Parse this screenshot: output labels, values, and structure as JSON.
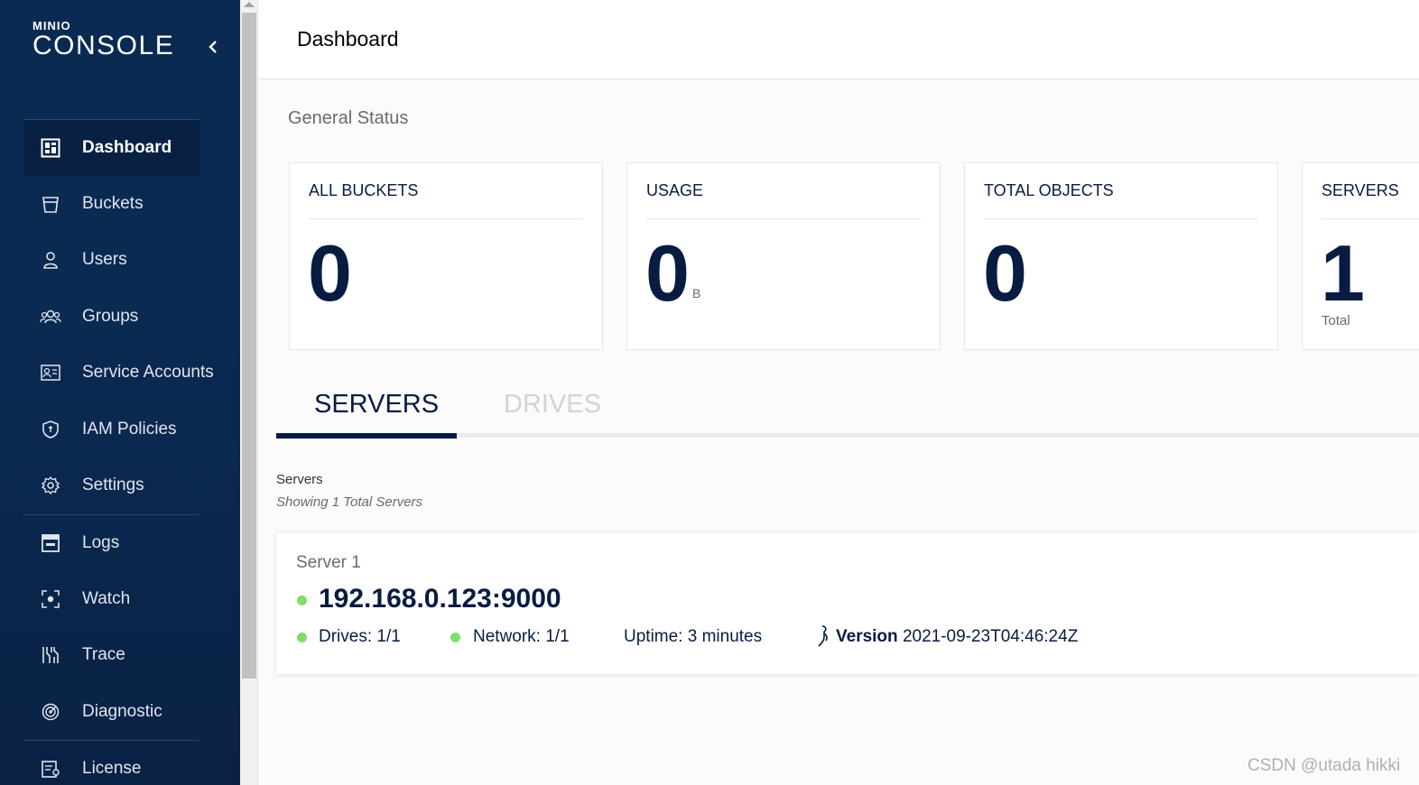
{
  "brand": {
    "top": "MINIO",
    "main": "CONSOLE"
  },
  "sidebar": {
    "items": [
      {
        "label": "Dashboard",
        "icon": "dashboard-icon"
      },
      {
        "label": "Buckets",
        "icon": "bucket-icon"
      },
      {
        "label": "Users",
        "icon": "user-icon"
      },
      {
        "label": "Groups",
        "icon": "groups-icon"
      },
      {
        "label": "Service Accounts",
        "icon": "service-accounts-icon"
      },
      {
        "label": "IAM Policies",
        "icon": "shield-icon"
      },
      {
        "label": "Settings",
        "icon": "gear-icon"
      },
      {
        "label": "Logs",
        "icon": "logs-icon"
      },
      {
        "label": "Watch",
        "icon": "watch-icon"
      },
      {
        "label": "Trace",
        "icon": "trace-icon"
      },
      {
        "label": "Diagnostic",
        "icon": "diagnostic-icon"
      },
      {
        "label": "License",
        "icon": "license-icon"
      }
    ],
    "active": "Dashboard"
  },
  "header": {
    "title": "Dashboard"
  },
  "general_status": {
    "title": "General Status",
    "cards": [
      {
        "title": "ALL BUCKETS",
        "value": "0"
      },
      {
        "title": "USAGE",
        "value": "0",
        "unit": "B"
      },
      {
        "title": "TOTAL OBJECTS",
        "value": "0"
      },
      {
        "title": "SERVERS",
        "value": "1",
        "sub": "Total"
      }
    ]
  },
  "tabs": [
    {
      "label": "SERVERS",
      "active": true
    },
    {
      "label": "DRIVES",
      "active": false
    }
  ],
  "servers_section": {
    "label": "Servers",
    "summary": "Showing 1 Total Servers",
    "server": {
      "name": "Server 1",
      "host": "192.168.0.123:9000",
      "drives": "Drives: 1/1",
      "network": "Network: 1/1",
      "uptime": "Uptime: 3 minutes",
      "version_label": "Version",
      "version_value": "2021-09-23T04:46:24Z"
    }
  },
  "watermark": "CSDN @utada hikki",
  "colors": {
    "sidebar": "#0b2a52",
    "accent": "#081c42",
    "status_ok": "#7ede6a"
  }
}
